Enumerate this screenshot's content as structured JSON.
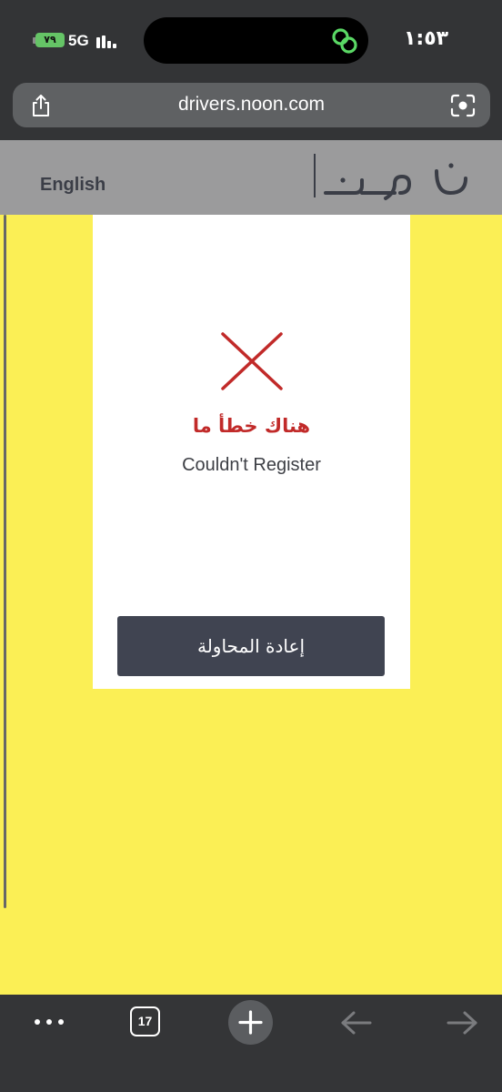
{
  "status_bar": {
    "battery": "٧٩",
    "network": "5G",
    "time": "١:٥٣",
    "link_icon_color": "#5ad865"
  },
  "browser": {
    "url": "drivers.noon.com",
    "tab_count": "17"
  },
  "header": {
    "language_link": "English",
    "logo_text": "نون",
    "logo_icon": "noon-logo-icon"
  },
  "error": {
    "icon": "close-x-icon",
    "title_ar": "هناك خطأ ما",
    "message": "Couldn't Register",
    "retry_label": "إعادة المحاولة"
  },
  "colors": {
    "page_background": "#fbef55",
    "header_background": "#9b9b9c",
    "error_red": "#c12a29",
    "button_background": "#404451"
  }
}
